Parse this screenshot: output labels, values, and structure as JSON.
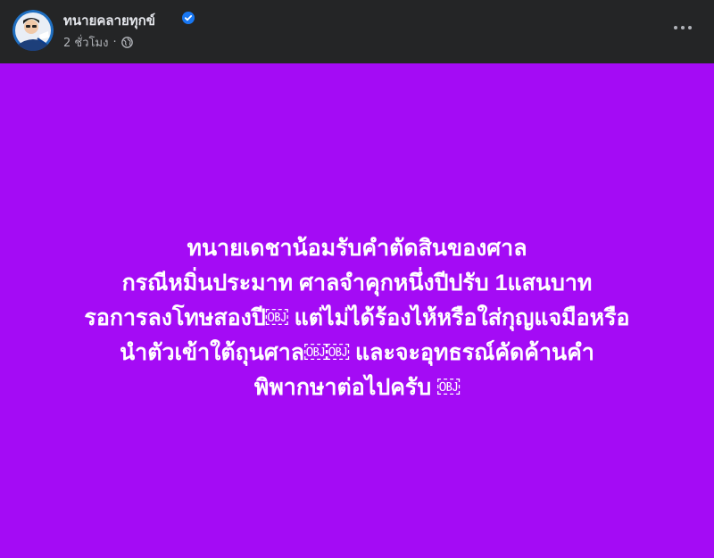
{
  "post": {
    "author": "ทนายคลายทุกข์",
    "time": "2 ชั่วโมง",
    "separator": "·",
    "icons": {
      "avatar": "avatar-photo",
      "verified": "verified-badge-icon",
      "audience": "globe-icon",
      "more": "more-options-icon"
    },
    "background_color": "#a40bf5",
    "text_lines": [
      "ทนายเดชาน้อมรับคำตัดสินของศาล",
      "กรณีหมิ่นประมาท ศาลจำคุกหนึ่งปีปรับ 1แสนบาท",
      "รอการลงโทษสองปี￼ แต่ไม่ได้ร้องไห้หรือใส่กุญแจมือหรือ",
      "นำตัวเข้าใต้ถุนศาล￼￼ และจะอุทธรณ์คัดค้านคำ",
      "พิพากษาต่อไปครับ ￼"
    ]
  }
}
